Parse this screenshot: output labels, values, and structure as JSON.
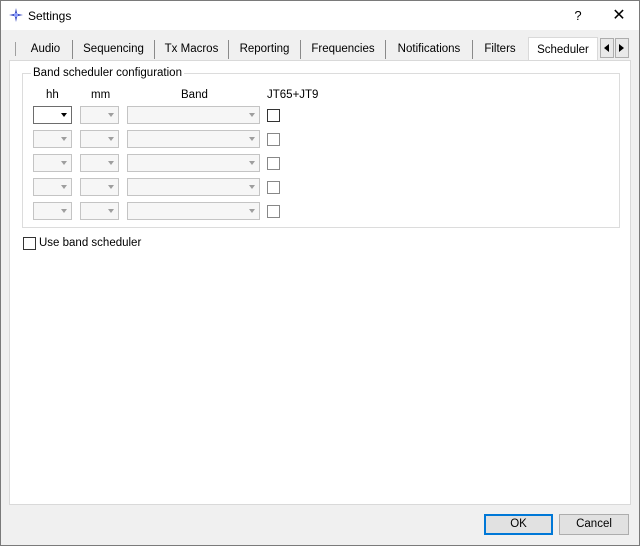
{
  "window": {
    "title": "Settings",
    "help_label": "?",
    "close_label": "✕",
    "accent_color": "#0078d7"
  },
  "tabs": {
    "items": [
      {
        "label": "Audio"
      },
      {
        "label": "Sequencing"
      },
      {
        "label": "Tx Macros"
      },
      {
        "label": "Reporting"
      },
      {
        "label": "Frequencies"
      },
      {
        "label": "Notifications"
      },
      {
        "label": "Filters"
      },
      {
        "label": "Scheduler"
      }
    ],
    "selected": "Scheduler",
    "scroll_left_icon": "triangle-left-icon",
    "scroll_right_icon": "triangle-right-icon"
  },
  "scheduler": {
    "group_title": "Band scheduler configuration",
    "columns": {
      "hh": "hh",
      "mm": "mm",
      "band": "Band",
      "mode": "JT65+JT9"
    },
    "rows": [
      {
        "hh": "",
        "mm": "",
        "band": "",
        "jt65_jt9": false,
        "enabled": true
      },
      {
        "hh": "",
        "mm": "",
        "band": "",
        "jt65_jt9": false,
        "enabled": false
      },
      {
        "hh": "",
        "mm": "",
        "band": "",
        "jt65_jt9": false,
        "enabled": false
      },
      {
        "hh": "",
        "mm": "",
        "band": "",
        "jt65_jt9": false,
        "enabled": false
      },
      {
        "hh": "",
        "mm": "",
        "band": "",
        "jt65_jt9": false,
        "enabled": false
      }
    ],
    "use_scheduler_label": "Use band scheduler",
    "use_scheduler_checked": false
  },
  "buttons": {
    "ok_label": "OK",
    "cancel_label": "Cancel"
  }
}
